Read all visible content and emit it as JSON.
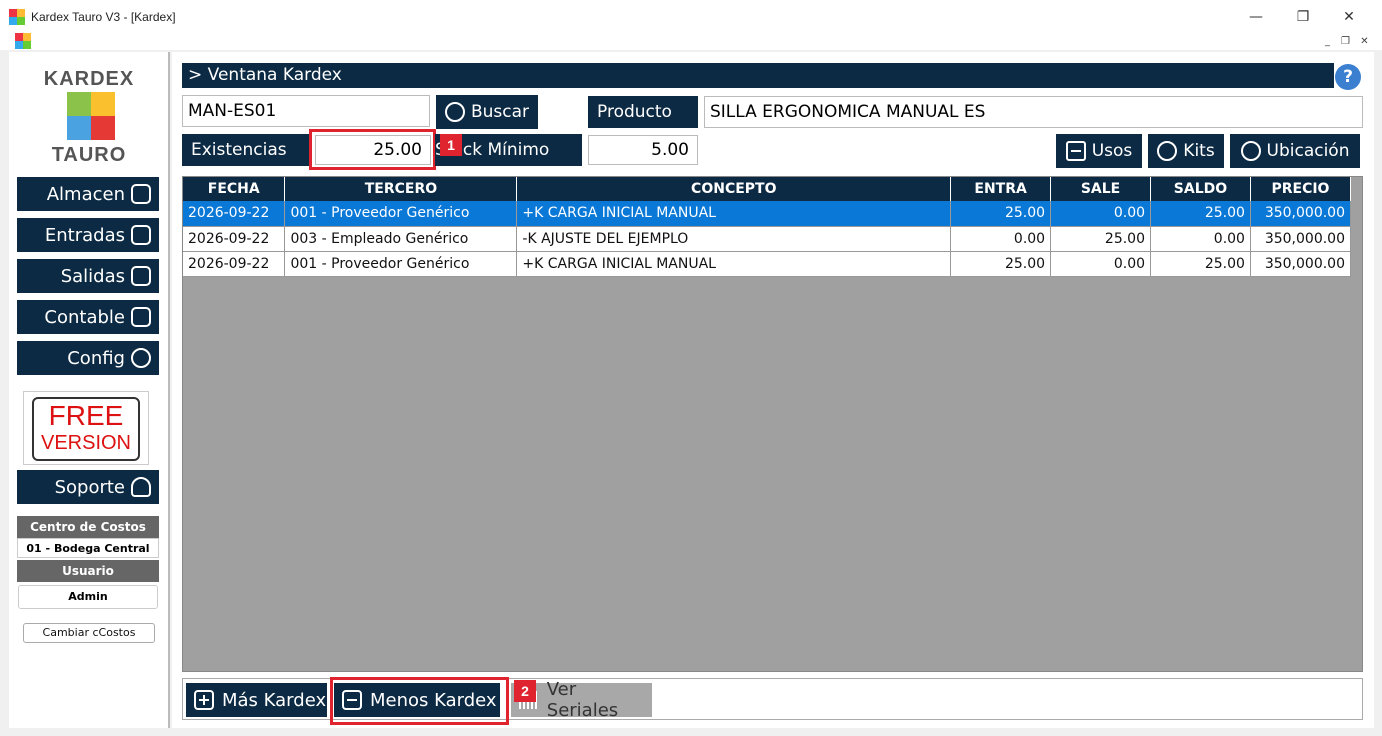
{
  "window": {
    "title": "Kardex Tauro V3 - [Kardex]"
  },
  "logo": {
    "top": "KARDEX",
    "bottom": "TAURO"
  },
  "nav": [
    {
      "label": "Almacen",
      "icon": "warehouse-icon"
    },
    {
      "label": "Entradas",
      "icon": "inbox-in-icon"
    },
    {
      "label": "Salidas",
      "icon": "inbox-out-icon"
    },
    {
      "label": "Contable",
      "icon": "book-icon"
    },
    {
      "label": "Config",
      "icon": "gear-icon"
    }
  ],
  "free": {
    "line1": "FREE",
    "line2": "VERSION"
  },
  "support": {
    "label": "Soporte",
    "icon": "user-support-icon"
  },
  "cost_center": {
    "header": "Centro de Costos",
    "value": "01 - Bodega Central"
  },
  "user": {
    "header": "Usuario",
    "value": "Admin"
  },
  "change_cc": {
    "label": "Cambiar cCostos"
  },
  "header": {
    "title": "> Ventana Kardex",
    "help": "?"
  },
  "search": {
    "code": "MAN-ES01",
    "button": "Buscar"
  },
  "product": {
    "label": "Producto",
    "value": "SILLA ERGONOMICA MANUAL ES"
  },
  "stock": {
    "label": "Existencias",
    "value": "25.00",
    "min_label": "Stock Mínimo",
    "min_value": "5.00"
  },
  "actions": {
    "usos": "Usos",
    "kits": "Kits",
    "ubicacion": "Ubicación"
  },
  "annotations": {
    "badge1": "1",
    "badge2": "2"
  },
  "table": {
    "columns": [
      "FECHA",
      "TERCERO",
      "CONCEPTO",
      "ENTRA",
      "SALE",
      "SALDO",
      "PRECIO"
    ],
    "rows": [
      [
        "2026-09-22",
        "001 - Proveedor Genérico",
        "+K CARGA INICIAL MANUAL",
        "25.00",
        "0.00",
        "25.00",
        "350,000.00"
      ],
      [
        "2026-09-22",
        "003 - Empleado Genérico",
        "-K AJUSTE DEL EJEMPLO",
        "0.00",
        "25.00",
        "0.00",
        "350,000.00"
      ],
      [
        "2026-09-22",
        "001 - Proveedor Genérico",
        "+K CARGA INICIAL MANUAL",
        "25.00",
        "0.00",
        "25.00",
        "350,000.00"
      ]
    ],
    "selected_row": 0
  },
  "bottom": {
    "mas": "Más Kardex",
    "menos": "Menos Kardex",
    "seriales": "Ver Seriales"
  },
  "colors": {
    "navy": "#0c2a43",
    "select": "#0a78d7",
    "highlight": "#e0242f"
  }
}
